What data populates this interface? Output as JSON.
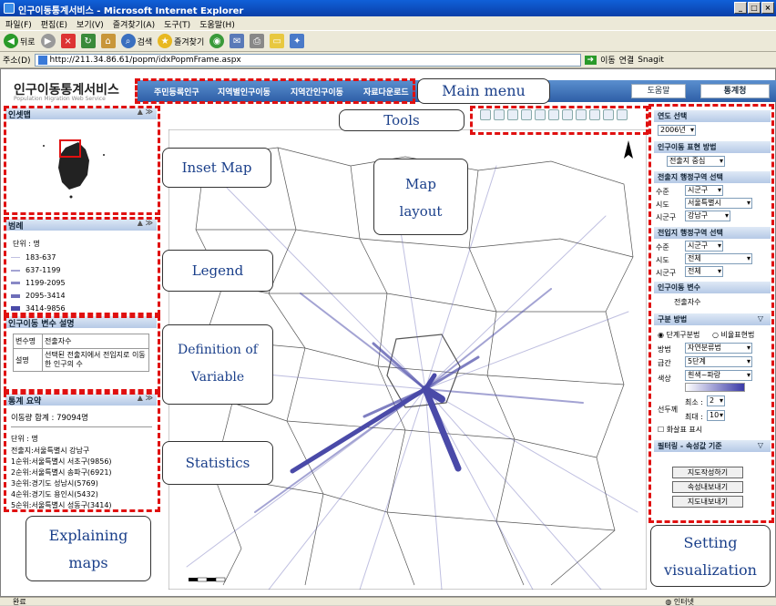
{
  "window": {
    "title": "인구이동통계서비스 - Microsoft Internet Explorer"
  },
  "menu": [
    "파일(F)",
    "편집(E)",
    "보기(V)",
    "즐겨찾기(A)",
    "도구(T)",
    "도움말(H)"
  ],
  "toolbar": {
    "back": "뒤로",
    "search": "검색",
    "favorites": "즐겨찾기"
  },
  "address": {
    "label": "주소(D)",
    "url": "http://211.34.86.61/popm/idxPopmFrame.aspx",
    "go": "이동",
    "links": "연결",
    "snagit": "Snagit"
  },
  "site": {
    "logo": "인구이동통계서비스",
    "logo_sub": "Population Migration Web Service"
  },
  "nav": {
    "items": [
      "주민등록인구",
      "지역별인구이동",
      "지역간인구이동",
      "자료다운로드"
    ],
    "help": "도움말",
    "stats": "통계청"
  },
  "panels": {
    "inset": "인셋맵",
    "legend": "범례",
    "definition": "인구이동 변수 설명",
    "summary": "통계 요약"
  },
  "legend": {
    "unit": "단위 : 명",
    "ranges": [
      "183-637",
      "637-1199",
      "1199-2095",
      "2095-3414",
      "3414-9856"
    ]
  },
  "definition": {
    "name_label": "변수명",
    "name_value": "전출자수",
    "desc_label": "설명",
    "desc_value": "선택된 전출지에서 전입지로 이동한 인구의 수"
  },
  "stats": {
    "total": "이동량 합계 : 79094명",
    "unit": "단위 : 명",
    "origin": "전출지:서울특별시 강남구",
    "ranks": [
      "1순위:서울특별시 서초구(9856)",
      "2순위:서울특별시 송파구(6921)",
      "3순위:경기도 성남시(5769)",
      "4순위:경기도 용인시(5432)",
      "5순위:서울특별시 성동구(3414)"
    ]
  },
  "settings": {
    "year_hdr": "연도 선택",
    "year": "2006년",
    "method_hdr": "인구이동 표현 방법",
    "method": "전출지 중심",
    "origin_hdr": "전출지 행정구역 선택",
    "level_label": "수준",
    "level": "시군구",
    "sido_label": "시도",
    "origin_sido": "서울특별시",
    "sigungu_label": "시군구",
    "origin_sigungu": "강남구",
    "dest_hdr": "전입지 행정구역 선택",
    "dest_level": "시군구",
    "dest_sido": "전체",
    "dest_sigungu": "전체",
    "var_hdr": "인구이동 변수",
    "var": "전출자수",
    "class_hdr": "구분 방법",
    "radio1": "단계구분법",
    "radio2": "비율표현법",
    "way_label": "방법",
    "way": "자연분류법",
    "interval_label": "급간",
    "interval": "5단계",
    "color_label": "색상",
    "color": "흰색~파랑",
    "line_label": "선두께",
    "min_label": "최소 :",
    "min": "2",
    "max_label": "최대 :",
    "max": "10",
    "arrow": "화살표 표시",
    "filter_hdr": "필터링 - 속성값 기준",
    "btn_draw": "지도작성하기",
    "btn_attr": "속성내보내기",
    "btn_map": "지도내보내기"
  },
  "annotations": {
    "main_menu": "Main menu",
    "tools": "Tools",
    "inset": "Inset Map",
    "map1": "Map",
    "map2": "layout",
    "legend": "Legend",
    "def1": "Definition of",
    "def2": "Variable",
    "stats": "Statistics",
    "explain1": "Explaining",
    "explain2": "maps",
    "setting1": "Setting",
    "setting2": "visualization"
  },
  "status": {
    "left": "완료",
    "right": "인터넷"
  },
  "colors": {
    "accent": "#2d5ea6",
    "flow": "#4a4aa8",
    "annot_border": "#e01010"
  }
}
